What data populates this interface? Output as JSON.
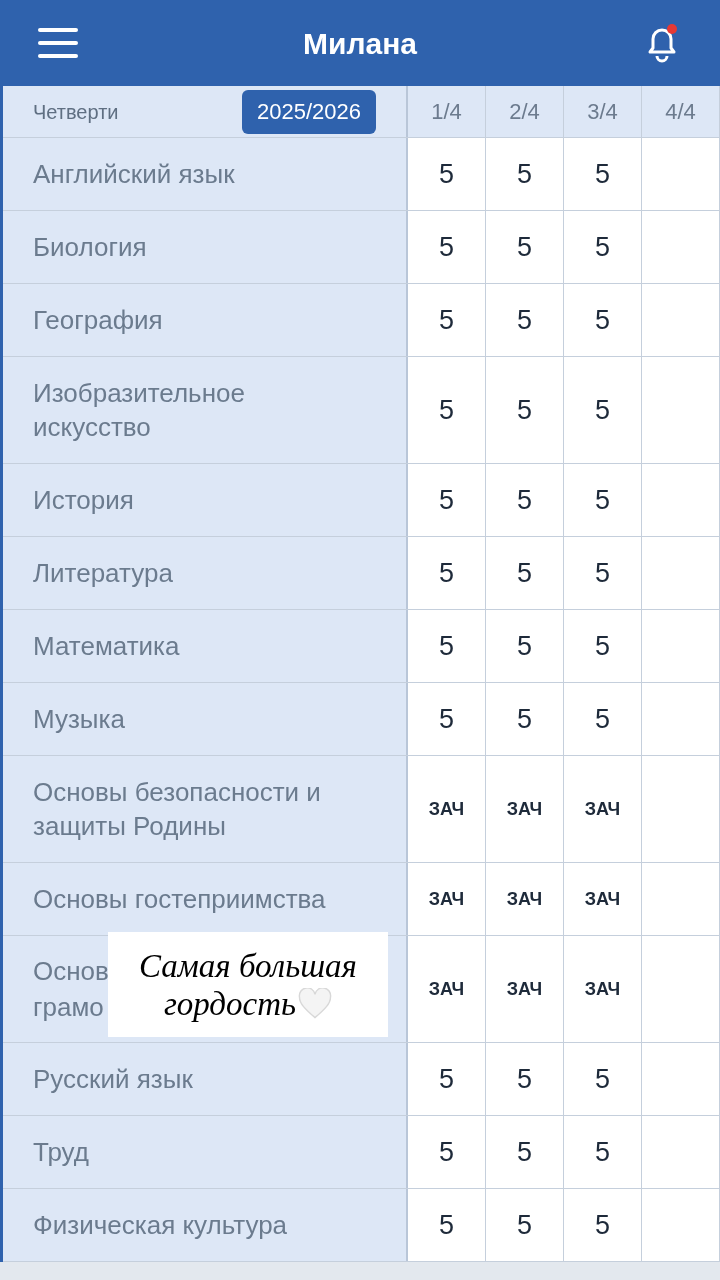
{
  "header": {
    "title": "Милана",
    "notifications": {
      "unread": true
    }
  },
  "table": {
    "period_label": "Четверти",
    "year": {
      "label": "2025/2026",
      "selected": true
    },
    "columns": [
      "1/4",
      "2/4",
      "3/4",
      "4/4"
    ],
    "rows": [
      {
        "subject": "Английский язык",
        "grades": [
          "5",
          "5",
          "5"
        ]
      },
      {
        "subject": "Биология",
        "grades": [
          "5",
          "5",
          "5"
        ]
      },
      {
        "subject": "География",
        "grades": [
          "5",
          "5",
          "5"
        ]
      },
      {
        "subject": "Изобразительное искусство",
        "grades": [
          "5",
          "5",
          "5"
        ]
      },
      {
        "subject": "История",
        "grades": [
          "5",
          "5",
          "5"
        ]
      },
      {
        "subject": "Литература",
        "grades": [
          "5",
          "5",
          "5"
        ]
      },
      {
        "subject": "Математика",
        "grades": [
          "5",
          "5",
          "5"
        ]
      },
      {
        "subject": "Музыка",
        "grades": [
          "5",
          "5",
          "5"
        ]
      },
      {
        "subject": "Основы безопасности и защиты Родины",
        "grades": [
          "ЗАЧ",
          "ЗАЧ",
          "ЗАЧ"
        ]
      },
      {
        "subject": "Основы гостеприимства",
        "grades": [
          "ЗАЧ",
          "ЗАЧ",
          "ЗАЧ"
        ]
      },
      {
        "subject_lines": [
          "Основ",
          "грамо"
        ],
        "grades": [
          "ЗАЧ",
          "ЗАЧ",
          "ЗАЧ"
        ],
        "caption": {
          "lines": [
            "Самая большая",
            "гордость"
          ]
        }
      },
      {
        "subject": "Русский язык",
        "grades": [
          "5",
          "5",
          "5"
        ]
      },
      {
        "subject": "Труд",
        "grades": [
          "5",
          "5",
          "5"
        ]
      },
      {
        "subject": "Физическая культура",
        "grades": [
          "5",
          "5",
          "5"
        ]
      }
    ]
  }
}
